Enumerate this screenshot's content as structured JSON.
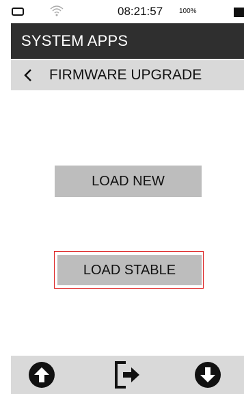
{
  "status_bar": {
    "time": "08:21:57",
    "battery_percent": "100%"
  },
  "header": {
    "title": "SYSTEM APPS"
  },
  "subheader": {
    "back_icon": "chevron-left-icon",
    "title": "FIRMWARE UPGRADE"
  },
  "main": {
    "load_new_label": "LOAD NEW",
    "load_stable_label": "LOAD STABLE",
    "selection_color": "#dd2222"
  },
  "footer": {
    "icons": [
      "arrow-up-circle-icon",
      "exit-icon",
      "arrow-down-circle-icon"
    ]
  },
  "colors": {
    "title_bar": "#2f2f2f",
    "bars": "#d9d9d9",
    "buttons": "#bdbdbd"
  }
}
